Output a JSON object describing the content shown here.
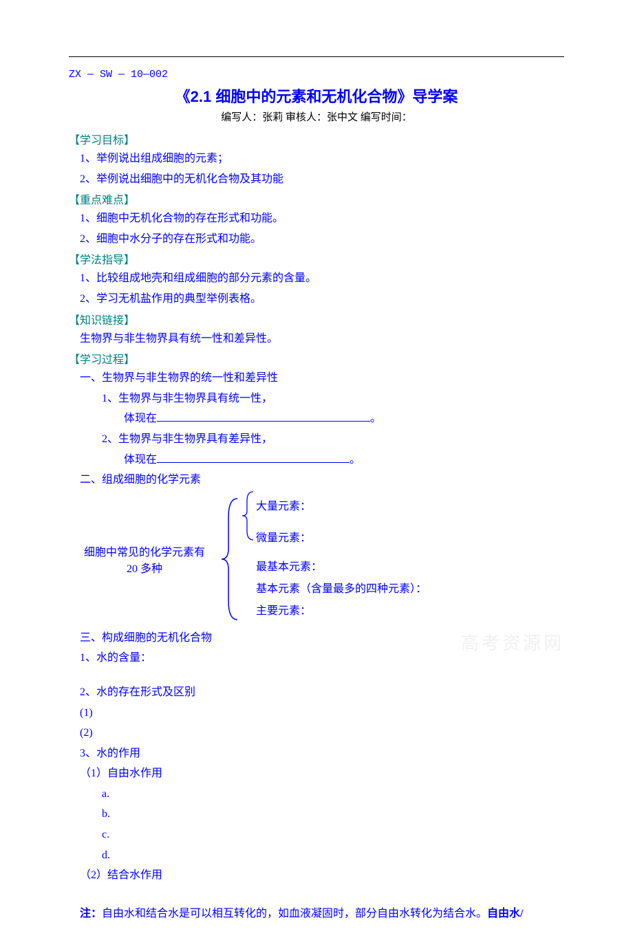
{
  "code": "ZX — SW — 10—002",
  "title": "《2.1 细胞中的元素和无机化合物》导学案",
  "authors": "编写人：张莉   审核人：张中文   编写时间：",
  "sections": {
    "s1": {
      "header": "【学习目标】",
      "l1": "1、举例说出组成细胞的元素；",
      "l2": "2、举例说出细胞中的无机化合物及其功能"
    },
    "s2": {
      "header": "【重点难点】",
      "l1": "1、细胞中无机化合物的存在形式和功能。",
      "l2": "2、细胞中水分子的存在形式和功能。"
    },
    "s3": {
      "header": "【学法指导】",
      "l1": "1、比较组成地壳和组成细胞的部分元素的含量。",
      "l2": "2、学习无机盐作用的典型举例表格。"
    },
    "s4": {
      "header": "【知识链接】",
      "l1": "生物界与非生物界具有统一性和差异性。"
    },
    "s5": {
      "header": "【学习过程】",
      "l1": "一、生物界与非生物界的统一性和差异性",
      "l2": "1、生物界与非生物界具有统一性，",
      "l3": "体现在",
      "l4": "2、生物界与非生物界具有差异性，",
      "l5": "体现在",
      "l6": "二、组成细胞的化学元素",
      "diagL1": "细胞中常见的化学元素有",
      "diagL2": "20 多种",
      "diagR1": "大量元素：",
      "diagR2": "微量元素：",
      "diagR3": "最基本元素：",
      "diagR4": "基本元素（含量最多的四种元素）：",
      "diagR5": "主要元素：",
      "l7": "三、构成细胞的无机化合物",
      "l8": "1、水的含量：",
      "l9": " 2、水的存在形式及区别",
      "l10": "(1)",
      "l11": "(2)",
      "l12": " 3、水的作用",
      "l13": "（1）自由水作用",
      "l14": "a.",
      "l15": "b.",
      "l16": "c.",
      "l17": "d.",
      "l18": "（2）结合水作用"
    }
  },
  "note": {
    "prefix": "注：",
    "text": "自由水和结合水是可以相互转化的，如血液凝固时，部分自由水转化为结合水。",
    "bold": "自由水/"
  },
  "punct": "。",
  "watermark": "高考资源网"
}
